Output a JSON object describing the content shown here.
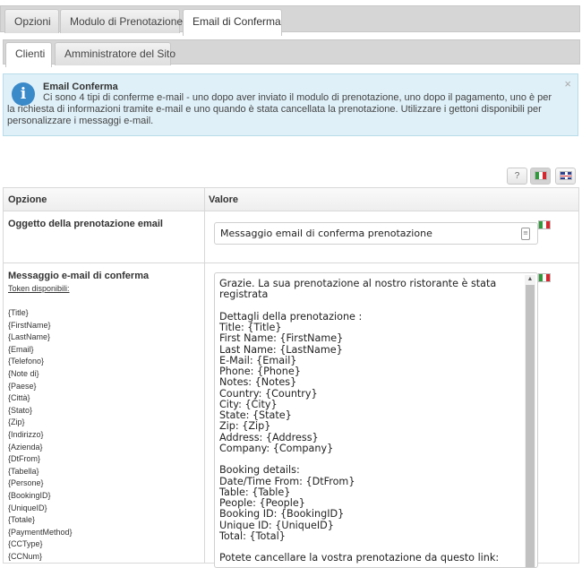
{
  "tabs": [
    "Opzioni",
    "Modulo di Prenotazione",
    "Email di Conferma"
  ],
  "subtabs": [
    "Clienti",
    "Amministratore del Sito"
  ],
  "info": {
    "title": "Email Conferma",
    "text": "Ci sono 4 tipi di conferme e-mail - uno dopo aver inviato il modulo di prenotazione, uno dopo il pagamento, uno è per la richiesta di informazioni tramite e-mail e uno quando è stata cancellata la prenotazione. Utilizzare i gettoni disponibili per personalizzare i messaggi e-mail.",
    "close": "×",
    "icon": "i"
  },
  "buttons": {
    "help": "?"
  },
  "table": {
    "col_option": "Opzione",
    "col_value": "Valore",
    "subject_label": "Oggetto della prenotazione email",
    "subject_value": "Messaggio email di conferma prenotazione",
    "message_label": "Messaggio e-mail di conferma",
    "tokens_label": "Token disponibili:",
    "tokens": [
      "{Title}",
      "{FirstName}",
      "{LastName}",
      "{Email}",
      "{Telefono}",
      "{Note di}",
      "{Paese}",
      "{Città}",
      "{Stato}",
      "{Zip}",
      "{Indirizzo}",
      "{Azienda}",
      "{DtFrom}",
      "{Tabella}",
      "{Persone}",
      "{BookingID}",
      "{UniqueID}",
      "{Totale}",
      "{PaymentMethod}",
      "{CCType}",
      "{CCNum}"
    ],
    "message_body": "Grazie. La sua prenotazione al nostro ristorante è stata registrata\n\nDettagli della prenotazione :\nTitle: {Title}\nFirst Name: {FirstName}\nLast Name: {LastName}\nE-Mail: {Email}\nPhone: {Phone}\nNotes: {Notes}\nCountry: {Country}\nCity: {City}\nState: {State}\nZip: {Zip}\nAddress: {Address}\nCompany: {Company}\n\nBooking details:\nDate/Time From: {DtFrom}\nTable: {Table}\nPeople: {People}\nBooking ID: {BookingID}\nUnique ID: {UniqueID}\nTotal: {Total}\n\nPotete cancellare la vostra prenotazione da questo link:"
  },
  "colors": {
    "info_bg": "#dff0f8",
    "info_icon": "#3a89c9"
  }
}
